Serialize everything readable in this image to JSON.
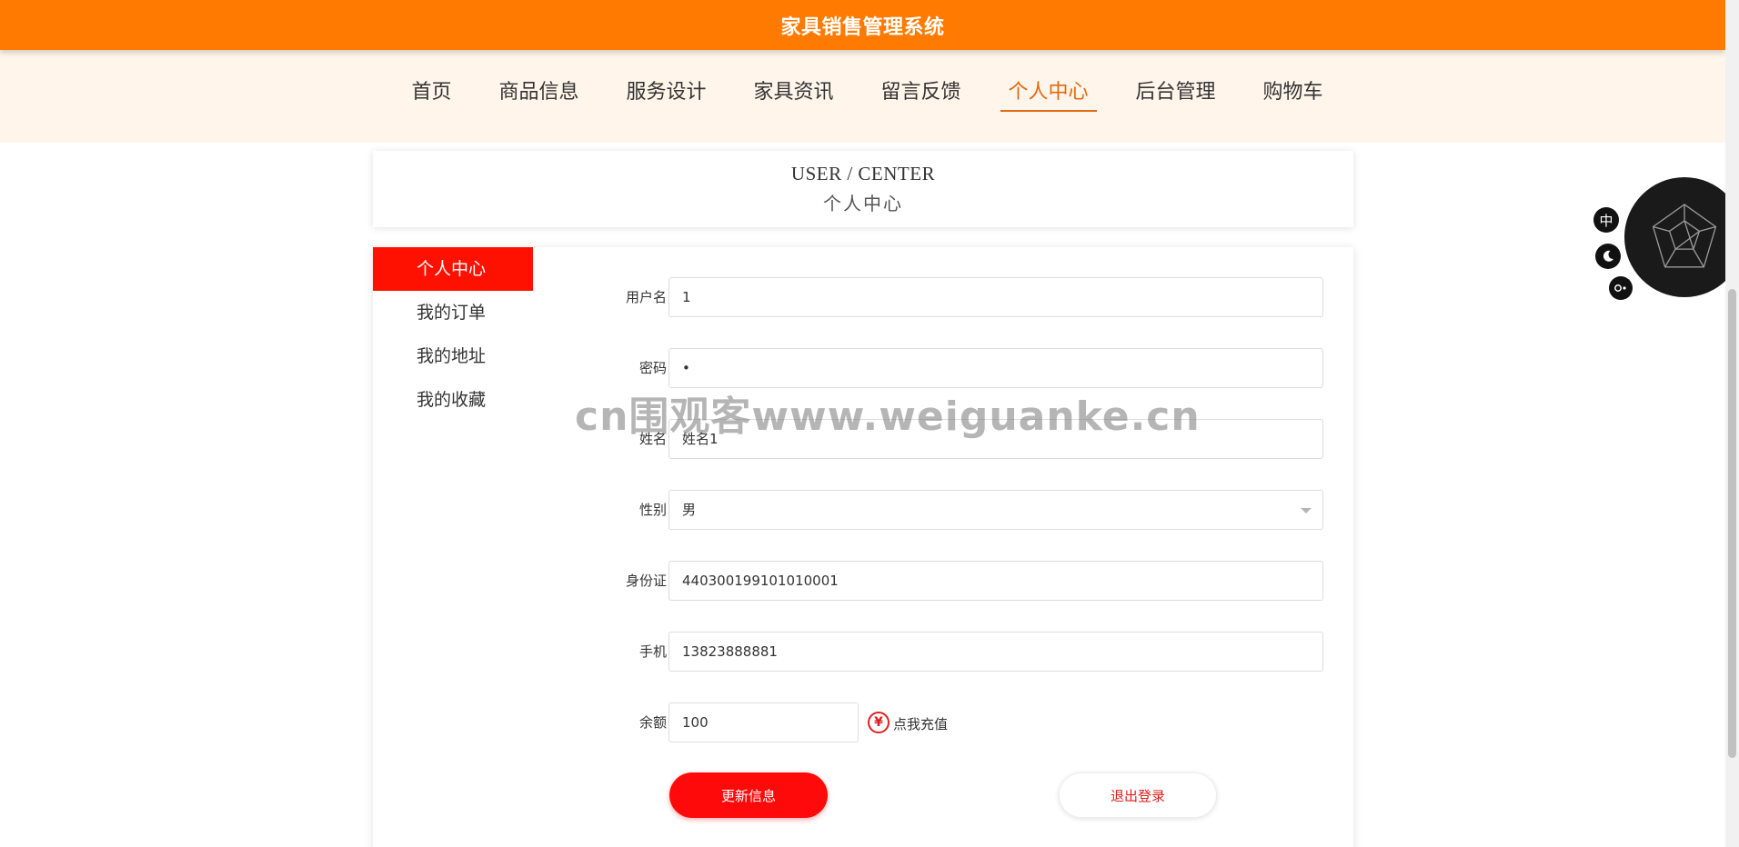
{
  "header": {
    "title": "家具销售管理系统",
    "accent_color": "#ff7a00"
  },
  "nav": {
    "items": [
      {
        "label": "首页"
      },
      {
        "label": "商品信息"
      },
      {
        "label": "服务设计"
      },
      {
        "label": "家具资讯"
      },
      {
        "label": "留言反馈"
      },
      {
        "label": "个人中心",
        "active": true
      },
      {
        "label": "后台管理"
      },
      {
        "label": "购物车"
      }
    ]
  },
  "page_heading": {
    "en": "USER / CENTER",
    "cn": "个人中心"
  },
  "sidemenu": {
    "items": [
      {
        "label": "个人中心",
        "active": true
      },
      {
        "label": "我的订单"
      },
      {
        "label": "我的地址"
      },
      {
        "label": "我的收藏"
      }
    ],
    "active_color": "#ff1100"
  },
  "form": {
    "username": {
      "label": "用户名",
      "value": "1"
    },
    "password": {
      "label": "密码",
      "value": "•"
    },
    "name": {
      "label": "姓名",
      "value": "姓名1"
    },
    "gender": {
      "label": "性别",
      "value": "男"
    },
    "id_card": {
      "label": "身份证",
      "value": "440300199101010001"
    },
    "phone": {
      "label": "手机",
      "value": "13823888881"
    },
    "balance": {
      "label": "余额",
      "value": "100",
      "recharge_label": "点我充值",
      "currency_symbol": "¥"
    },
    "update_button": "更新信息",
    "logout_button": "退出登录"
  },
  "watermark": {
    "text": "cn围观客www.weiguanke.cn"
  },
  "tools": {
    "lang_label": "中",
    "theme_icon": "moon-icon",
    "toggle_icon": "toggle-icon"
  }
}
